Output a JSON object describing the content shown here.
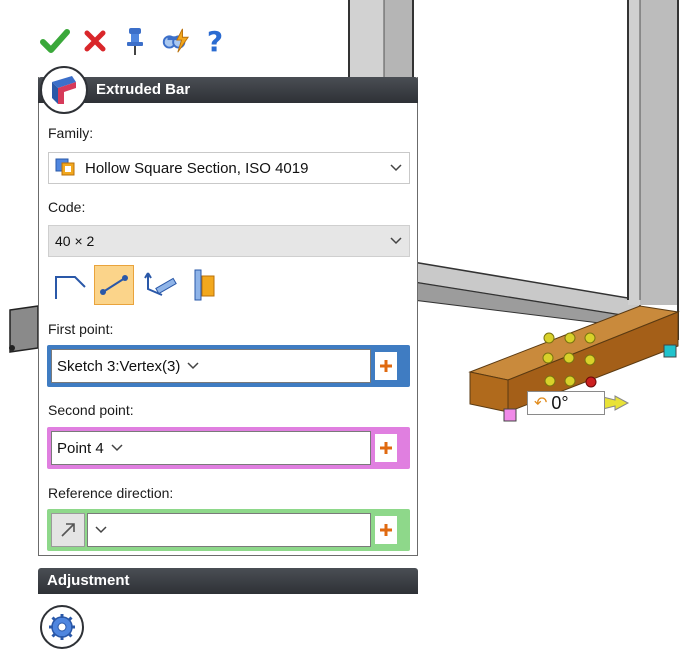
{
  "toolbar": {
    "ok_icon": "checkmark-icon",
    "cancel_icon": "cross-icon",
    "pin_icon": "pushpin-icon",
    "preview_icon": "detailed-preview-icon",
    "help_label": "?"
  },
  "panel": {
    "title": "Extruded Bar",
    "family_label": "Family:",
    "family_value": "Hollow Square Section, ISO 4019",
    "code_label": "Code:",
    "code_value": "40 × 2",
    "first_point_label": "First point:",
    "first_point_value": "Sketch 3:Vertex(3)",
    "second_point_label": "Second point:",
    "second_point_value": "Point 4",
    "reference_direction_label": "Reference direction:",
    "reference_direction_value": "",
    "modes": [
      "line-segment-icon",
      "two-points-icon",
      "point-direction-length-icon",
      "face-align-icon"
    ]
  },
  "adjustment": {
    "title": "Adjustment"
  },
  "viewport": {
    "angle_value": "0°"
  },
  "colors": {
    "first_point_frame": "#3f7cc2",
    "second_point_frame": "#e07fe0",
    "reference_frame": "#8ed88a",
    "active_mode": "#fbd48a",
    "bar_color": "#b8731f"
  }
}
